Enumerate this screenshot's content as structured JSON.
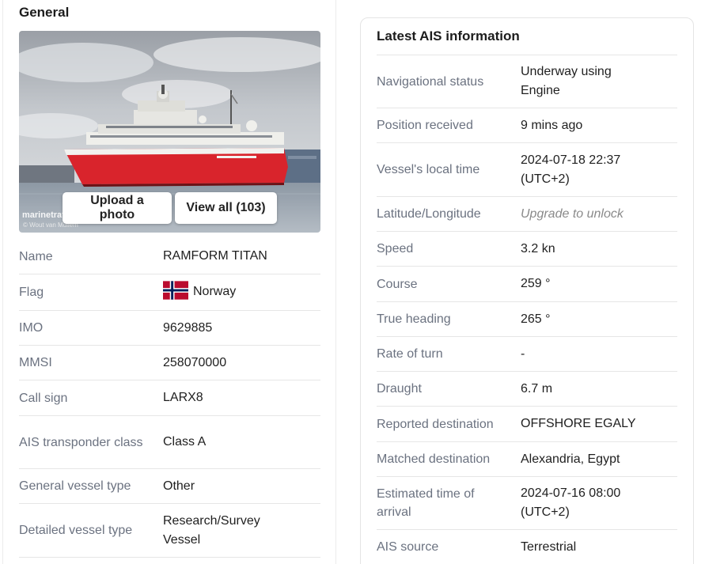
{
  "general": {
    "title": "General",
    "photo": {
      "upload_label": "Upload a photo",
      "view_all_label": "View all (103)",
      "watermark": "marinetraffic",
      "credit": "© Wout van Mullem"
    },
    "rows": [
      {
        "key": "Name",
        "value": "RAMFORM TITAN"
      },
      {
        "key": "Flag",
        "value": "Norway",
        "icon": "norway-flag-icon"
      },
      {
        "key": "IMO",
        "value": "9629885"
      },
      {
        "key": "MMSI",
        "value": "258070000"
      },
      {
        "key": "Call sign",
        "value": "LARX8"
      },
      {
        "key": "AIS transponder class",
        "value": "Class A"
      },
      {
        "key": "General vessel type",
        "value": "Other"
      },
      {
        "key": "Detailed vessel type",
        "value": "Research/Survey Vessel"
      }
    ]
  },
  "ais": {
    "title": "Latest AIS information",
    "rows": [
      {
        "key": "Navigational status",
        "value": "Underway using Engine"
      },
      {
        "key": "Position received",
        "value": "9 mins ago"
      },
      {
        "key": "Vessel's local time",
        "value": "2024-07-18 22:37 (UTC+2)"
      },
      {
        "key": "Latitude/Longitude",
        "value": "Upgrade to unlock",
        "locked": true
      },
      {
        "key": "Speed",
        "value": "3.2 kn"
      },
      {
        "key": "Course",
        "value": "259 °"
      },
      {
        "key": "True heading",
        "value": "265 °"
      },
      {
        "key": "Rate of turn",
        "value": "-"
      },
      {
        "key": "Draught",
        "value": "6.7 m"
      },
      {
        "key": "Reported destination",
        "value": "OFFSHORE EGALY"
      },
      {
        "key": "Matched destination",
        "value": "Alexandria, Egypt"
      },
      {
        "key": "Estimated time of arrival",
        "value": "2024-07-16 08:00 (UTC+2)"
      },
      {
        "key": "AIS source",
        "value": "Terrestrial"
      }
    ]
  },
  "colors": {
    "hull_red": "#d9242c",
    "flag_red": "#ba0c2f",
    "flag_blue": "#00205b"
  }
}
